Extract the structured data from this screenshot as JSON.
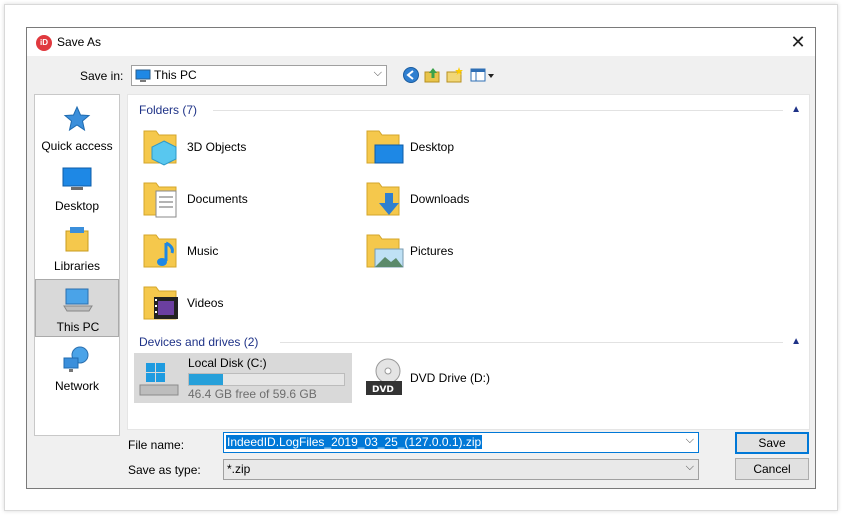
{
  "dialog": {
    "title": "Save As",
    "close_label": "✕",
    "app_icon_text": "iD"
  },
  "toolbar": {
    "save_in_label": "Save in:",
    "save_in_value": "This PC",
    "dropdown_arrow": "⌵"
  },
  "places": [
    {
      "label": "Quick access"
    },
    {
      "label": "Desktop"
    },
    {
      "label": "Libraries"
    },
    {
      "label": "This PC",
      "selected": true
    },
    {
      "label": "Network"
    }
  ],
  "folders": {
    "header": "Folders (7)",
    "items": [
      {
        "label": "3D Objects"
      },
      {
        "label": "Desktop"
      },
      {
        "label": "Documents"
      },
      {
        "label": "Downloads"
      },
      {
        "label": "Music"
      },
      {
        "label": "Pictures"
      },
      {
        "label": "Videos"
      }
    ]
  },
  "devices": {
    "header": "Devices and drives (2)",
    "items": [
      {
        "label": "Local Disk (C:)",
        "free_text": "46.4 GB free of 59.6 GB",
        "used_fraction": 0.22
      },
      {
        "label": "DVD Drive (D:)"
      }
    ]
  },
  "form": {
    "file_name_label": "File name:",
    "file_name_value": "IndeedID.LogFiles_2019_03_25_(127.0.0.1).zip",
    "save_type_label": "Save as type:",
    "save_type_value": "*.zip",
    "save_button": "Save",
    "cancel_button": "Cancel"
  },
  "colors": {
    "accent": "#0078d7",
    "group_header": "#1e3287",
    "drive_bar": "#26a0da"
  }
}
